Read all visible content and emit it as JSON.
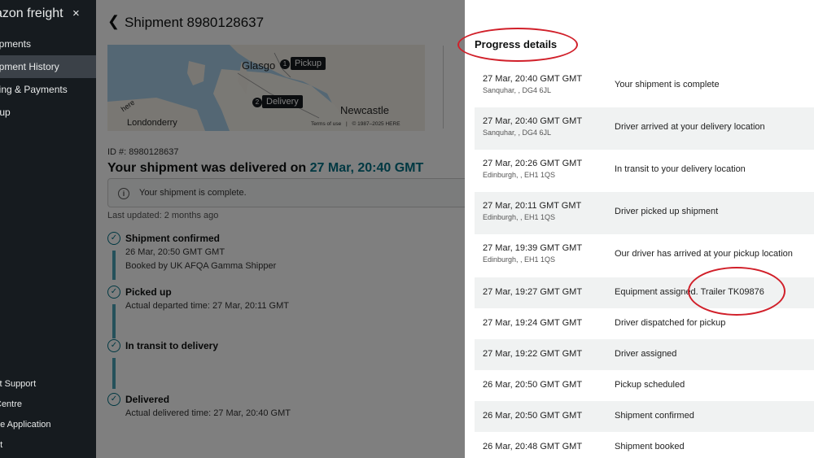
{
  "sidebar": {
    "brand": "azon freight",
    "close_icon": "×",
    "items": [
      {
        "label": "ipments",
        "active": false
      },
      {
        "label": "ipment History",
        "active": true
      },
      {
        "label": "ling & Payments",
        "active": false
      },
      {
        "label": "tup",
        "active": false
      }
    ],
    "footer_items": [
      {
        "label": "ct Support"
      },
      {
        "label": "Centre"
      },
      {
        "label": "he Application"
      },
      {
        "label": "ut"
      }
    ]
  },
  "main": {
    "title": "Shipment 8980128637",
    "map": {
      "labels": {
        "glasgow": "Glasgo",
        "newcastle": "Newcastle",
        "londonderry": "Londonderry",
        "here": "here"
      },
      "pickup_label": "Pickup",
      "delivery_label": "Delivery",
      "pickup_num": "1",
      "delivery_num": "2",
      "terms": "Terms of use",
      "copyright": "© 1987–2025 HERE"
    },
    "id_line": "ID #: 8980128637",
    "headline_prefix": "Your shipment was delivered on ",
    "headline_date": "27 Mar, 20:40 GMT",
    "alert_icon": "i",
    "alert_text": "Your shipment is complete.",
    "last_updated": "Last updated: 2 months ago",
    "timeline": [
      {
        "title": "Shipment confirmed",
        "lines": [
          "26 Mar, 20:50 GMT GMT",
          "Booked by UK AFQA Gamma Shipper"
        ]
      },
      {
        "title": "Picked up",
        "lines": [
          "Actual departed time: 27 Mar, 20:11 GMT"
        ]
      },
      {
        "title": "In transit to delivery",
        "lines": []
      },
      {
        "title": "Delivered",
        "lines": [
          "Actual delivered time: 27 Mar, 20:40 GMT"
        ]
      }
    ]
  },
  "progress": {
    "title": "Progress details",
    "rows": [
      {
        "time": "27 Mar, 20:40 GMT GMT",
        "location": "Sanquhar, , DG4 6JL",
        "event": "Your shipment is complete"
      },
      {
        "time": "27 Mar, 20:40 GMT GMT",
        "location": "Sanquhar, , DG4 6JL",
        "event": "Driver arrived at your delivery location"
      },
      {
        "time": "27 Mar, 20:26 GMT GMT",
        "location": "Edinburgh, , EH1 1QS",
        "event": "In transit to your delivery location"
      },
      {
        "time": "27 Mar, 20:11 GMT GMT",
        "location": "Edinburgh, , EH1 1QS",
        "event": "Driver picked up shipment"
      },
      {
        "time": "27 Mar, 19:39 GMT GMT",
        "location": "Edinburgh, , EH1 1QS",
        "event": "Our driver has arrived at your pickup location"
      },
      {
        "time": "27 Mar, 19:27 GMT GMT",
        "location": "",
        "event": "Equipment assigned. Trailer TK09876"
      },
      {
        "time": "27 Mar, 19:24 GMT GMT",
        "location": "",
        "event": "Driver dispatched for pickup"
      },
      {
        "time": "27 Mar, 19:22 GMT GMT",
        "location": "",
        "event": "Driver assigned"
      },
      {
        "time": "26 Mar, 20:50 GMT GMT",
        "location": "",
        "event": "Pickup scheduled"
      },
      {
        "time": "26 Mar, 20:50 GMT GMT",
        "location": "",
        "event": "Shipment confirmed"
      },
      {
        "time": "26 Mar, 20:48 GMT GMT",
        "location": "",
        "event": "Shipment booked"
      }
    ]
  },
  "colors": {
    "accent": "#007185",
    "annotation": "#d1202a",
    "sidebar": "#161b1f"
  }
}
